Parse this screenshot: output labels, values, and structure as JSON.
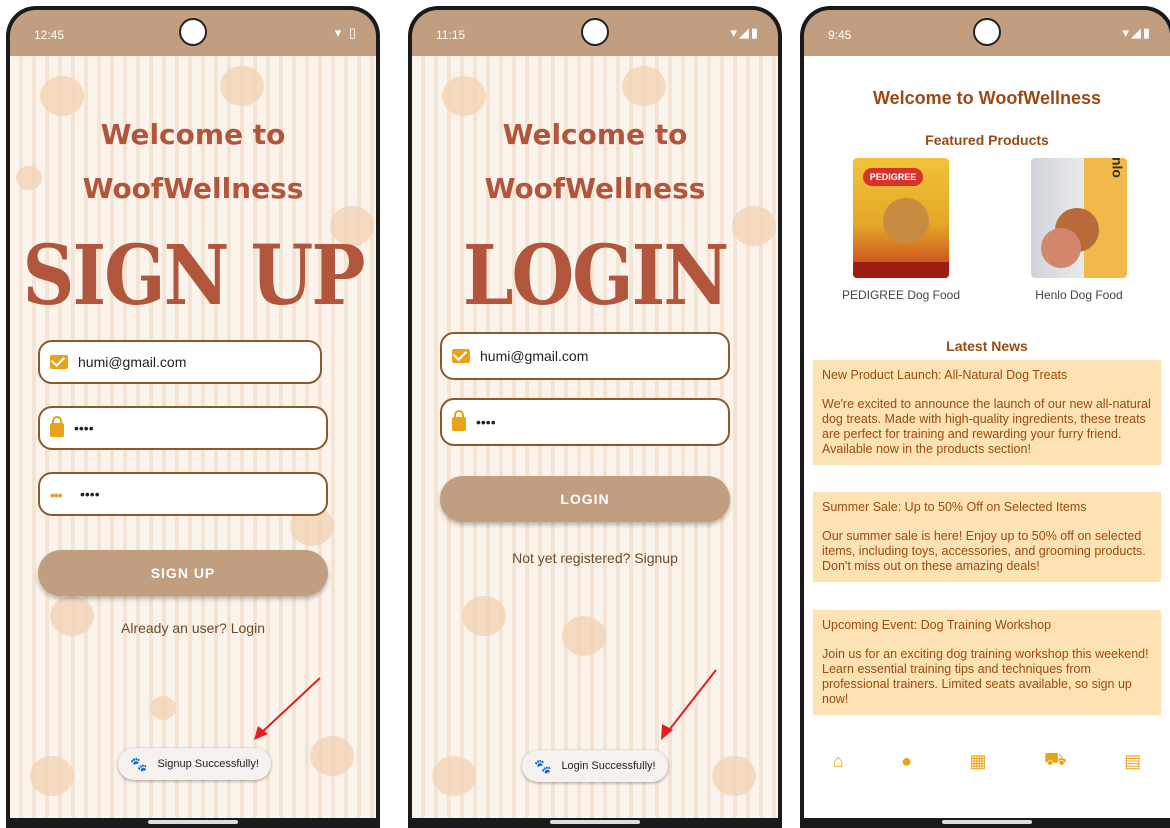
{
  "signup_screen": {
    "status_time": "12:45",
    "welcome_line1": "Welcome to",
    "welcome_line2": "WoofWellness",
    "big_title": "SIGN UP",
    "email_value": "humi@gmail.com",
    "password_value": "••••",
    "confirm_password_value": "••••",
    "button_label": "SIGN UP",
    "login_link": "Already an user? Login",
    "toast_message": "Signup Successfully!"
  },
  "login_screen": {
    "status_time": "11:15",
    "welcome_line1": "Welcome to",
    "welcome_line2": "WoofWellness",
    "big_title": "LOGIN",
    "email_value": "humi@gmail.com",
    "password_value": "••••",
    "button_label": "LOGIN",
    "signup_link": "Not yet registered? Signup",
    "toast_message": "Login Successfully!"
  },
  "home_screen": {
    "status_time": "9:45",
    "title": "Welcome to WoofWellness",
    "featured_heading": "Featured Products",
    "products": [
      {
        "label": "PEDIGREE Dog Food",
        "packaging_text": "PEDIGREE"
      },
      {
        "label": "Henlo Dog Food",
        "packaging_text": "henlo"
      }
    ],
    "news_heading": "Latest News",
    "news": [
      {
        "title": "New Product Launch: All-Natural Dog Treats",
        "body": "We're excited to announce the launch of our new all-natural dog treats. Made with high-quality ingredients, these treats are perfect for training and rewarding your furry friend. Available now in the products section!"
      },
      {
        "title": "Summer Sale: Up to 50% Off on Selected Items",
        "body": "Our summer sale is here! Enjoy up to 50% off on selected items, including toys, accessories, and grooming products. Don't miss out on these amazing deals!"
      },
      {
        "title": "Upcoming Event: Dog Training Workshop",
        "body": "Join us for an exciting dog training workshop this weekend! Learn essential training tips and techniques from professional trainers. Limited seats available, so sign up now!"
      }
    ],
    "nav_icons": [
      "home-icon",
      "profile-icon",
      "store-add-icon",
      "cart-icon",
      "news-icon"
    ]
  },
  "colors": {
    "status_bar": "#c19e7f",
    "title_brown": "#b2553d",
    "accent_orange": "#e8a317",
    "news_card": "#fde3b3",
    "news_text": "#9a4a12",
    "button": "#c19e7f"
  }
}
